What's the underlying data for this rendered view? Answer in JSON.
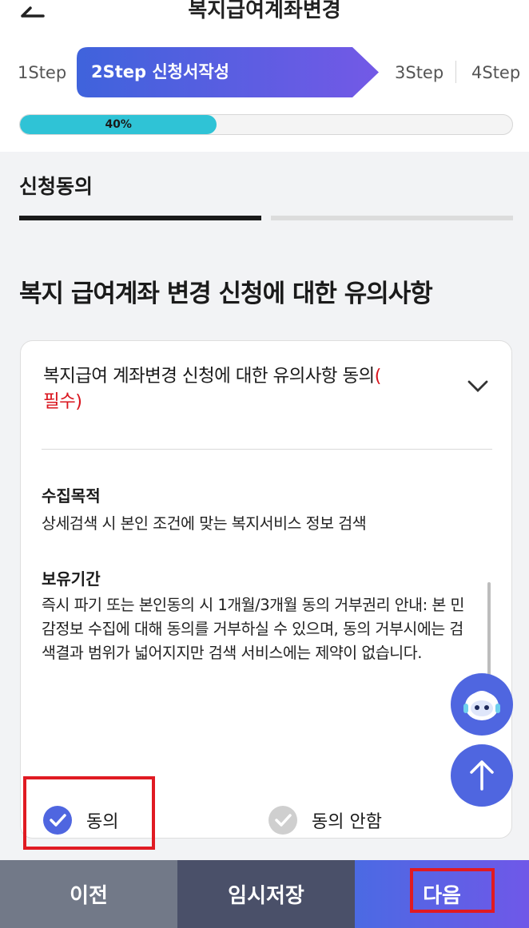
{
  "header": {
    "title": "복지급여계좌변경"
  },
  "steps": [
    {
      "label": "1Step"
    },
    {
      "label": "2Step 신청서작성"
    },
    {
      "label": "3Step"
    },
    {
      "label": "4Step"
    }
  ],
  "progress": {
    "percent": 40,
    "label": "40%"
  },
  "section_tab": "신청동의",
  "heading": "복지 급여계좌 변경 신청에 대한 유의사항",
  "card": {
    "title": "복지급여 계좌변경 신청에 대한 유의사항 동의",
    "required_open": "(",
    "required_text": "필수)",
    "purpose_label": "수집목적",
    "purpose_text": "상세검색 시 본인 조건에 맞는 복지서비스 정보 검색",
    "retention_label": "보유기간",
    "retention_text": "즉시 파기 또는 본인동의 시 1개월/3개월 동의 거부권리 안내: 본 민감정보 수집에 대해 동의를 거부하실 수 있으며, 동의 거부시에는 검색결과 범위가 넓어지지만 검색 서비스에는 제약이 없습니다.",
    "agree_label": "동의",
    "disagree_label": "동의 안함",
    "agree_checked": true
  },
  "buttons": {
    "prev": "이전",
    "save": "임시저장",
    "next": "다음"
  },
  "colors": {
    "accent": "#4f66e0",
    "progress": "#2fc3d6",
    "highlight": "#e01a22",
    "required": "#d9151e"
  }
}
